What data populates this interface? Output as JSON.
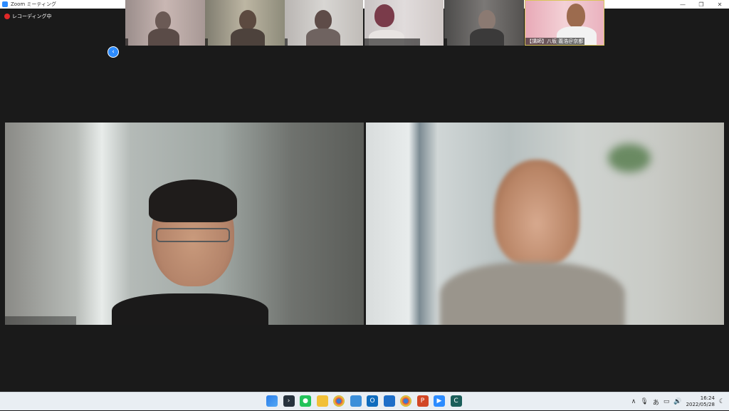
{
  "window": {
    "title": "Zoom ミーティング",
    "controls": {
      "minimize": "—",
      "restore": "❐",
      "close": "✕"
    }
  },
  "recording": {
    "label": "レコーディング中"
  },
  "gallery": {
    "nav_prev": "‹",
    "thumbnails": [
      {
        "name": ""
      },
      {
        "name": ""
      },
      {
        "name": ""
      },
      {
        "name": ""
      },
      {
        "name": ""
      },
      {
        "name": "【講師】八坂 義浩＠京都"
      }
    ]
  },
  "taskbar": {
    "icons": [
      "windows-start-icon",
      "terminal-icon",
      "line-icon",
      "file-explorer-icon",
      "chrome-icon",
      "notepad-icon",
      "outlook-icon",
      "remote-desktop-icon",
      "chrome-badge-icon",
      "powerpoint-icon",
      "zoom-icon",
      "app-icon"
    ],
    "tray": {
      "chevron": "∧",
      "mic": "🎙",
      "ime": "あ",
      "network": "▭",
      "volume": "🔊",
      "notification": "☾"
    },
    "clock": {
      "time": "16:24",
      "date": "2022/05/28"
    }
  },
  "colors": {
    "accent": "#2d8cff",
    "record": "#e02828",
    "background": "#1a1a1a"
  }
}
